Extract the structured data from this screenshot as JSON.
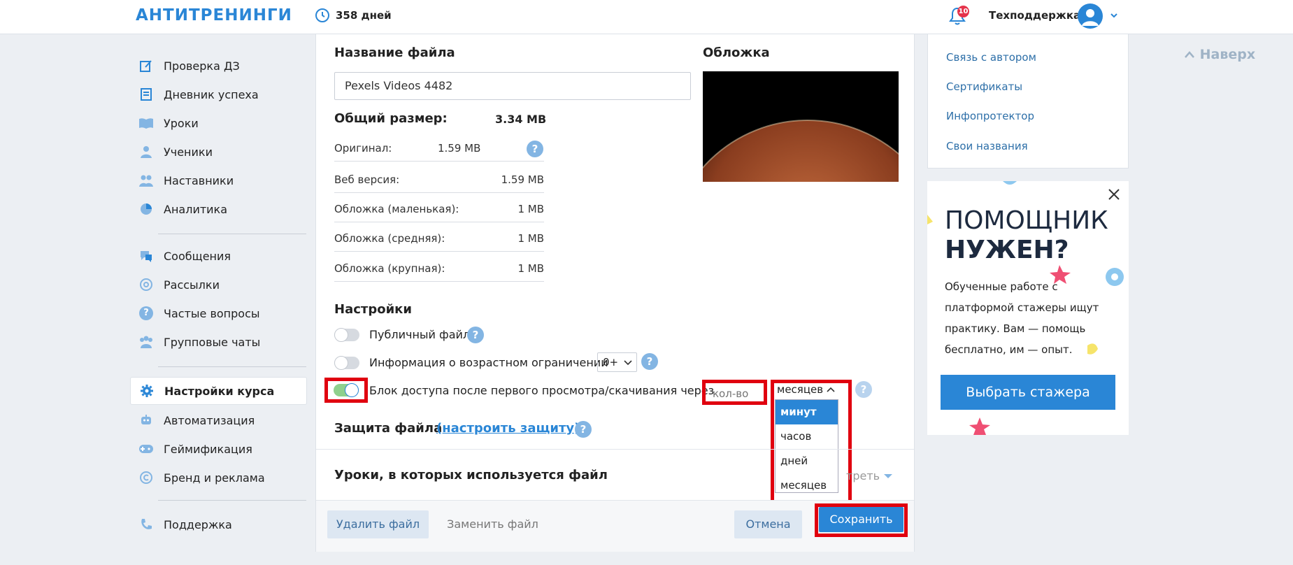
{
  "header": {
    "logo": "АНТИТРЕНИНГИ",
    "days": "358 дней",
    "notifications_count": "10",
    "support_label": "Техподдержка"
  },
  "sidebar": {
    "items": [
      {
        "label": "Проверка ДЗ",
        "icon": "edit-icon"
      },
      {
        "label": "Дневник успеха",
        "icon": "diary-icon"
      },
      {
        "label": "Уроки",
        "icon": "book-icon"
      },
      {
        "label": "Ученики",
        "icon": "students-icon"
      },
      {
        "label": "Наставники",
        "icon": "mentors-icon"
      },
      {
        "label": "Аналитика",
        "icon": "pie-chart-icon"
      },
      {
        "label": "Сообщения",
        "icon": "messages-icon"
      },
      {
        "label": "Рассылки",
        "icon": "at-icon"
      },
      {
        "label": "Частые вопросы",
        "icon": "question-icon"
      },
      {
        "label": "Групповые чаты",
        "icon": "group-icon"
      },
      {
        "label": "Настройки курса",
        "icon": "gear-icon"
      },
      {
        "label": "Автоматизация",
        "icon": "robot-icon"
      },
      {
        "label": "Геймификация",
        "icon": "gamepad-icon"
      },
      {
        "label": "Бренд и реклама",
        "icon": "copyright-icon"
      },
      {
        "label": "Поддержка",
        "icon": "phone-icon"
      }
    ]
  },
  "file": {
    "name_label": "Название файла",
    "name_value": "Pexels Videos 4482",
    "cover_label": "Обложка",
    "total_size_label": "Общий размер:",
    "total_size_value": "3.34 MB",
    "sizes": [
      {
        "label": "Оригинал:",
        "value": "1.59 MB"
      },
      {
        "label": "Веб версия:",
        "value": "1.59 MB"
      },
      {
        "label": "Обложка (маленькая):",
        "value": "1 MB"
      },
      {
        "label": "Обложка (средняя):",
        "value": "1 MB"
      },
      {
        "label": "Обложка (крупная):",
        "value": "1 MB"
      }
    ]
  },
  "settings": {
    "title": "Настройки",
    "public_file": "Публичный файл",
    "age_restriction": "Информация о возрастном ограничении",
    "age_value": "0+",
    "access_block": "Блок доступа после первого просмотра/скачивания через",
    "qty_placeholder": "кол-во",
    "period_selected": "месяцев",
    "period_options": [
      "минут",
      "часов",
      "дней",
      "месяцев"
    ],
    "protection_label": "Защита файла",
    "protection_link": "(настроить защиту)",
    "public_on": false,
    "age_on": false,
    "access_on": true
  },
  "lessons": {
    "title": "Уроки, в которых используется файл",
    "view_partial": "треть"
  },
  "footer": {
    "delete": "Удалить файл",
    "replace": "Заменить файл",
    "cancel": "Отмена",
    "save": "Сохранить"
  },
  "right_links": [
    "Связь с автором",
    "Сертификаты",
    "Инфопротектор",
    "Свои названия"
  ],
  "promo": {
    "title_line1": "ПОМОЩНИК",
    "title_line2": "НУЖЕН?",
    "text": "Обученные работе с платформой стажеры ищут практику. Вам — помощь бесплатно, им — опыт.",
    "button": "Выбрать стажера"
  },
  "up_button": "Наверх",
  "colors": {
    "accent": "#2a86d6",
    "highlight": "#e0000f",
    "toggle_on": "#8fd08d"
  }
}
